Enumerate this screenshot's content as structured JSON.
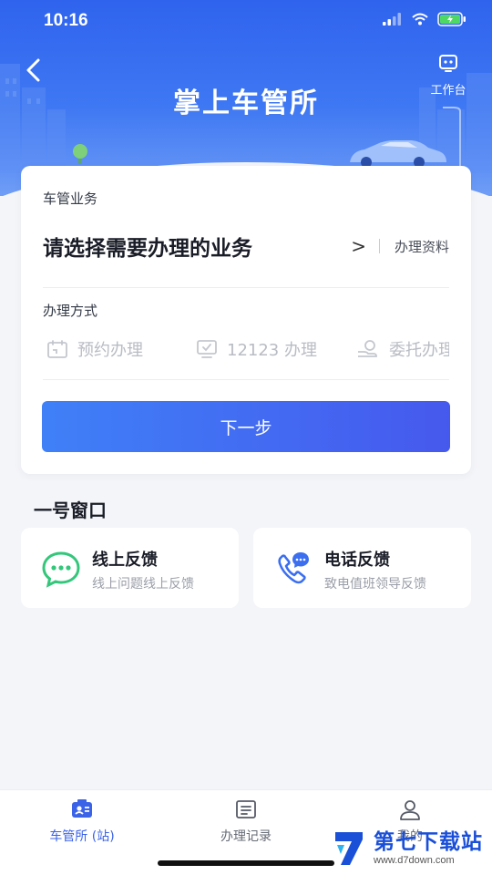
{
  "status_bar": {
    "time": "10:16",
    "icons": [
      "signal-icon",
      "wifi-icon",
      "battery-charging-icon"
    ]
  },
  "header": {
    "title": "掌上车管所",
    "back_icon": "chevron-left-icon",
    "workbench_label": "工作台",
    "workbench_icon": "robot-icon"
  },
  "card": {
    "business_label": "车管业务",
    "business_placeholder": "请选择需要办理的业务",
    "business_arrow": ">",
    "materials_label": "办理资料",
    "method_label": "办理方式",
    "methods": [
      {
        "label": "预约办理",
        "icon": "calendar-icon"
      },
      {
        "label": "12123 办理",
        "icon": "monitor-check-icon"
      },
      {
        "label": "委托办理",
        "icon": "hand-money-icon"
      }
    ],
    "next_button": "下一步"
  },
  "window_section": {
    "title": "一号窗口",
    "cards": [
      {
        "title": "线上反馈",
        "subtitle": "线上问题线上反馈",
        "icon": "chat-bubble-icon"
      },
      {
        "title": "电话反馈",
        "subtitle": "致电值班领导反馈",
        "icon": "phone-chat-icon"
      }
    ]
  },
  "tabbar": {
    "tabs": [
      {
        "label": "车管所 (站)",
        "icon": "id-card-icon",
        "active": true
      },
      {
        "label": "办理记录",
        "icon": "record-list-icon",
        "active": false
      },
      {
        "label": "我的",
        "icon": "user-icon",
        "active": false
      }
    ]
  },
  "watermark": {
    "title": "第七下载站",
    "url": "www.d7down.com"
  },
  "colors": {
    "primary": "#3b63e8",
    "header_top": "#2f63ee",
    "feedback_green": "#34c77b",
    "feedback_blue": "#3b6ff0"
  }
}
